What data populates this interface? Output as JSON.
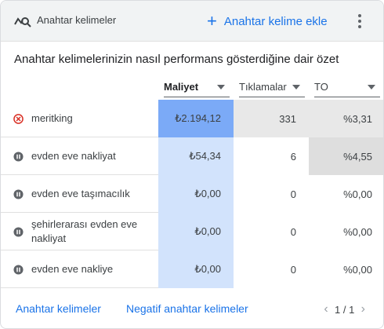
{
  "header": {
    "title": "Anahtar kelimeler",
    "add_label": "Anahtar kelime ekle"
  },
  "summary_title": "Anahtar kelimelerinizin nasıl performans gösterdiğine dair özet",
  "columns": [
    "Maliyet",
    "Tıklamalar",
    "TO"
  ],
  "rows": [
    {
      "keyword": "meritking",
      "status_icon": "disapproved-icon",
      "cost": "₺2.194,12",
      "clicks": "331",
      "ctr": "%3,31"
    },
    {
      "keyword": "evden eve nakliyat",
      "status_icon": "paused-icon",
      "cost": "₺54,34",
      "clicks": "6",
      "ctr": "%4,55"
    },
    {
      "keyword": "evden eve taşımacılık",
      "status_icon": "paused-icon",
      "cost": "₺0,00",
      "clicks": "0",
      "ctr": "%0,00"
    },
    {
      "keyword": "şehirlerarası evden eve nakliyat",
      "status_icon": "paused-icon",
      "cost": "₺0,00",
      "clicks": "0",
      "ctr": "%0,00"
    },
    {
      "keyword": "evden eve nakliye",
      "status_icon": "paused-icon",
      "cost": "₺0,00",
      "clicks": "0",
      "ctr": "%0,00"
    }
  ],
  "heat_colors": {
    "cost_high": "#7baaf7",
    "cost_low": "#d2e3fc",
    "clicks_high": "#e8e8e8",
    "ctr_high": "#e0e0e0",
    "ctr_mid": "#e8e8e8"
  },
  "footer": {
    "keywords_link": "Anahtar kelimeler",
    "negative_link": "Negatif anahtar kelimeler",
    "pagination": "1 / 1"
  }
}
